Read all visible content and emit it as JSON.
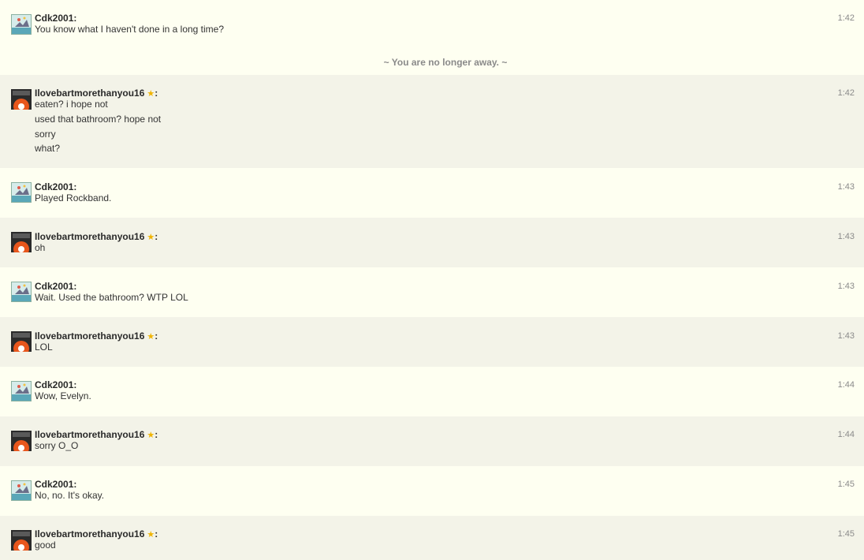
{
  "status_notice": "~ You are no longer away. ~",
  "messages": [
    {
      "sender": "Cdk2001",
      "time": "1:42",
      "lines": [
        "You know what I haven't done in a long time?"
      ]
    },
    {
      "sender": "Ilovebartmorethanyou16",
      "time": "1:42",
      "lines": [
        "eaten? i hope not",
        "used that bathroom? hope not",
        "sorry",
        "what?"
      ]
    },
    {
      "sender": "Cdk2001",
      "time": "1:43",
      "lines": [
        "Played Rockband."
      ]
    },
    {
      "sender": "Ilovebartmorethanyou16",
      "time": "1:43",
      "lines": [
        "oh"
      ]
    },
    {
      "sender": "Cdk2001",
      "time": "1:43",
      "lines": [
        "Wait. Used the bathroom? WTP LOL"
      ]
    },
    {
      "sender": "Ilovebartmorethanyou16",
      "time": "1:43",
      "lines": [
        "LOL"
      ]
    },
    {
      "sender": "Cdk2001",
      "time": "1:44",
      "lines": [
        "Wow, Evelyn."
      ]
    },
    {
      "sender": "Ilovebartmorethanyou16",
      "time": "1:44",
      "lines": [
        "sorry O_O"
      ]
    },
    {
      "sender": "Cdk2001",
      "time": "1:45",
      "lines": [
        "No, no. It's okay."
      ]
    },
    {
      "sender": "Ilovebartmorethanyou16",
      "time": "1:45",
      "lines": [
        "good"
      ]
    }
  ],
  "colors": {
    "row_light": "#fefff1",
    "row_alt": "#f3f3e8",
    "star": "#f0b400",
    "timestamp": "#8a8a8a"
  },
  "icons": {
    "premium": "star-icon",
    "cdk_avatar": "avatar-image",
    "bart_avatar": "avatar-image"
  }
}
